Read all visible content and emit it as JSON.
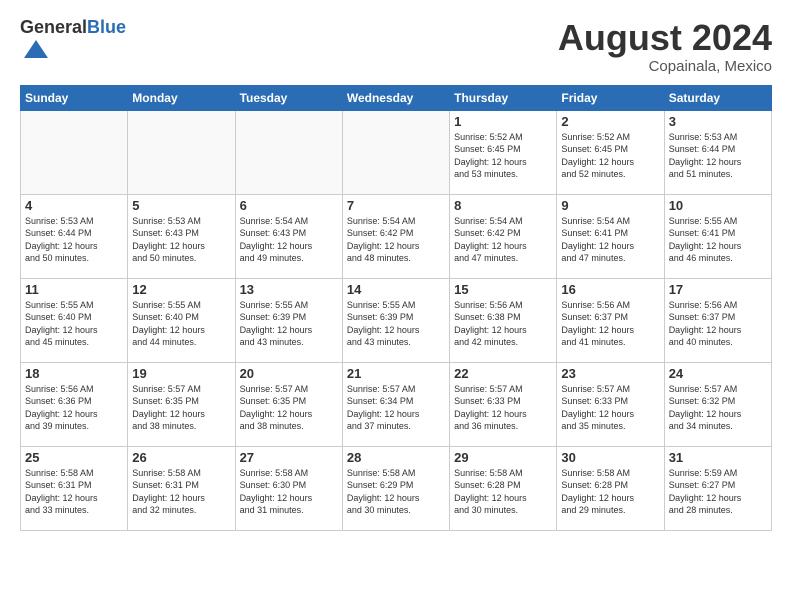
{
  "header": {
    "logo_general": "General",
    "logo_blue": "Blue",
    "title": "August 2024",
    "location": "Copainala, Mexico"
  },
  "days_of_week": [
    "Sunday",
    "Monday",
    "Tuesday",
    "Wednesday",
    "Thursday",
    "Friday",
    "Saturday"
  ],
  "weeks": [
    [
      {
        "day": "",
        "info": ""
      },
      {
        "day": "",
        "info": ""
      },
      {
        "day": "",
        "info": ""
      },
      {
        "day": "",
        "info": ""
      },
      {
        "day": "1",
        "info": "Sunrise: 5:52 AM\nSunset: 6:45 PM\nDaylight: 12 hours\nand 53 minutes."
      },
      {
        "day": "2",
        "info": "Sunrise: 5:52 AM\nSunset: 6:45 PM\nDaylight: 12 hours\nand 52 minutes."
      },
      {
        "day": "3",
        "info": "Sunrise: 5:53 AM\nSunset: 6:44 PM\nDaylight: 12 hours\nand 51 minutes."
      }
    ],
    [
      {
        "day": "4",
        "info": "Sunrise: 5:53 AM\nSunset: 6:44 PM\nDaylight: 12 hours\nand 50 minutes."
      },
      {
        "day": "5",
        "info": "Sunrise: 5:53 AM\nSunset: 6:43 PM\nDaylight: 12 hours\nand 50 minutes."
      },
      {
        "day": "6",
        "info": "Sunrise: 5:54 AM\nSunset: 6:43 PM\nDaylight: 12 hours\nand 49 minutes."
      },
      {
        "day": "7",
        "info": "Sunrise: 5:54 AM\nSunset: 6:42 PM\nDaylight: 12 hours\nand 48 minutes."
      },
      {
        "day": "8",
        "info": "Sunrise: 5:54 AM\nSunset: 6:42 PM\nDaylight: 12 hours\nand 47 minutes."
      },
      {
        "day": "9",
        "info": "Sunrise: 5:54 AM\nSunset: 6:41 PM\nDaylight: 12 hours\nand 47 minutes."
      },
      {
        "day": "10",
        "info": "Sunrise: 5:55 AM\nSunset: 6:41 PM\nDaylight: 12 hours\nand 46 minutes."
      }
    ],
    [
      {
        "day": "11",
        "info": "Sunrise: 5:55 AM\nSunset: 6:40 PM\nDaylight: 12 hours\nand 45 minutes."
      },
      {
        "day": "12",
        "info": "Sunrise: 5:55 AM\nSunset: 6:40 PM\nDaylight: 12 hours\nand 44 minutes."
      },
      {
        "day": "13",
        "info": "Sunrise: 5:55 AM\nSunset: 6:39 PM\nDaylight: 12 hours\nand 43 minutes."
      },
      {
        "day": "14",
        "info": "Sunrise: 5:55 AM\nSunset: 6:39 PM\nDaylight: 12 hours\nand 43 minutes."
      },
      {
        "day": "15",
        "info": "Sunrise: 5:56 AM\nSunset: 6:38 PM\nDaylight: 12 hours\nand 42 minutes."
      },
      {
        "day": "16",
        "info": "Sunrise: 5:56 AM\nSunset: 6:37 PM\nDaylight: 12 hours\nand 41 minutes."
      },
      {
        "day": "17",
        "info": "Sunrise: 5:56 AM\nSunset: 6:37 PM\nDaylight: 12 hours\nand 40 minutes."
      }
    ],
    [
      {
        "day": "18",
        "info": "Sunrise: 5:56 AM\nSunset: 6:36 PM\nDaylight: 12 hours\nand 39 minutes."
      },
      {
        "day": "19",
        "info": "Sunrise: 5:57 AM\nSunset: 6:35 PM\nDaylight: 12 hours\nand 38 minutes."
      },
      {
        "day": "20",
        "info": "Sunrise: 5:57 AM\nSunset: 6:35 PM\nDaylight: 12 hours\nand 38 minutes."
      },
      {
        "day": "21",
        "info": "Sunrise: 5:57 AM\nSunset: 6:34 PM\nDaylight: 12 hours\nand 37 minutes."
      },
      {
        "day": "22",
        "info": "Sunrise: 5:57 AM\nSunset: 6:33 PM\nDaylight: 12 hours\nand 36 minutes."
      },
      {
        "day": "23",
        "info": "Sunrise: 5:57 AM\nSunset: 6:33 PM\nDaylight: 12 hours\nand 35 minutes."
      },
      {
        "day": "24",
        "info": "Sunrise: 5:57 AM\nSunset: 6:32 PM\nDaylight: 12 hours\nand 34 minutes."
      }
    ],
    [
      {
        "day": "25",
        "info": "Sunrise: 5:58 AM\nSunset: 6:31 PM\nDaylight: 12 hours\nand 33 minutes."
      },
      {
        "day": "26",
        "info": "Sunrise: 5:58 AM\nSunset: 6:31 PM\nDaylight: 12 hours\nand 32 minutes."
      },
      {
        "day": "27",
        "info": "Sunrise: 5:58 AM\nSunset: 6:30 PM\nDaylight: 12 hours\nand 31 minutes."
      },
      {
        "day": "28",
        "info": "Sunrise: 5:58 AM\nSunset: 6:29 PM\nDaylight: 12 hours\nand 30 minutes."
      },
      {
        "day": "29",
        "info": "Sunrise: 5:58 AM\nSunset: 6:28 PM\nDaylight: 12 hours\nand 30 minutes."
      },
      {
        "day": "30",
        "info": "Sunrise: 5:58 AM\nSunset: 6:28 PM\nDaylight: 12 hours\nand 29 minutes."
      },
      {
        "day": "31",
        "info": "Sunrise: 5:59 AM\nSunset: 6:27 PM\nDaylight: 12 hours\nand 28 minutes."
      }
    ]
  ]
}
